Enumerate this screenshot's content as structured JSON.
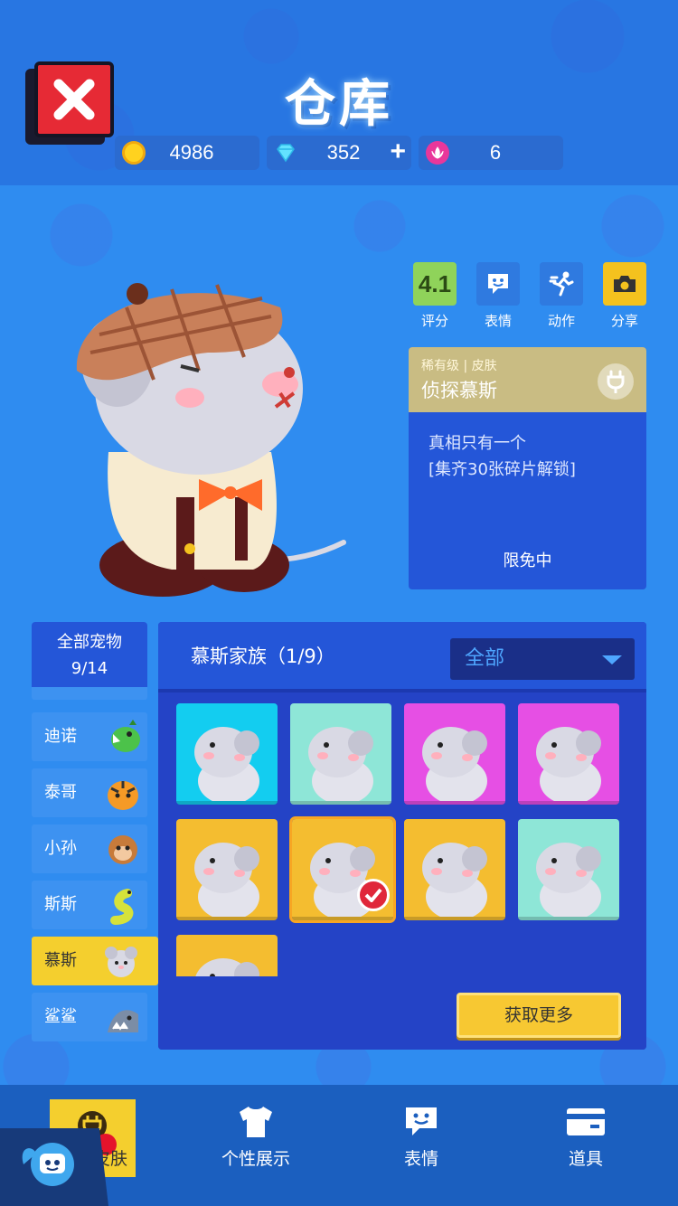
{
  "header": {
    "title": "仓库",
    "currencies": [
      {
        "icon": "gold-coin-icon",
        "value": "4986"
      },
      {
        "icon": "diamond-icon",
        "value": "352",
        "has_plus": true
      },
      {
        "icon": "lotus-token-icon",
        "value": "6"
      }
    ]
  },
  "actions": [
    {
      "name": "rating",
      "badge": "4.1",
      "label": "评分",
      "color": "#8fd35a"
    },
    {
      "name": "emote",
      "icon": "chat-smile-icon",
      "label": "表情",
      "color": "#2f7ae0"
    },
    {
      "name": "motion",
      "icon": "running-icon",
      "label": "动作",
      "color": "#2f7ae0"
    },
    {
      "name": "share",
      "icon": "camera-icon",
      "label": "分享",
      "color": "#f4c21e"
    }
  ],
  "skin_info": {
    "rarity": "稀有级",
    "type": "皮肤",
    "name": "侦探慕斯",
    "desc_line1": "真相只有一个",
    "desc_line2": "[集齐30张碎片解锁]",
    "status": "限免中"
  },
  "pets": {
    "title": "全部宠物",
    "count": "9/14",
    "items": [
      {
        "label": "迪诺",
        "icon": "dino-icon"
      },
      {
        "label": "泰哥",
        "icon": "tiger-icon"
      },
      {
        "label": "小孙",
        "icon": "monkey-icon"
      },
      {
        "label": "斯斯",
        "icon": "snake-icon"
      },
      {
        "label": "慕斯",
        "icon": "mouse-icon",
        "active": true
      },
      {
        "label": "鲨鲨",
        "icon": "shark-icon"
      }
    ]
  },
  "family": {
    "title": "慕斯家族（1/9）",
    "filter": "全部",
    "more_button": "获取更多",
    "tiles": [
      {
        "bg": "#13cdf0"
      },
      {
        "bg": "#8ee6d7"
      },
      {
        "bg": "#e64fe4"
      },
      {
        "bg": "#e64fe4"
      },
      {
        "bg": "#f4bd30"
      },
      {
        "bg": "#f4bd30",
        "selected": true
      },
      {
        "bg": "#f4bd30"
      },
      {
        "bg": "#8ee6d7"
      },
      {
        "bg": "#f4bd30"
      }
    ]
  },
  "nav": [
    {
      "label": "宠物皮肤",
      "icon": "plug-icon",
      "active": true
    },
    {
      "label": "个性展示",
      "icon": "tshirt-icon"
    },
    {
      "label": "表情",
      "icon": "chat-smile-icon"
    },
    {
      "label": "道具",
      "icon": "card-icon"
    }
  ],
  "colors": {
    "accent": "#f4cf2e",
    "primary": "#2456d8",
    "close": "#e62a35"
  }
}
